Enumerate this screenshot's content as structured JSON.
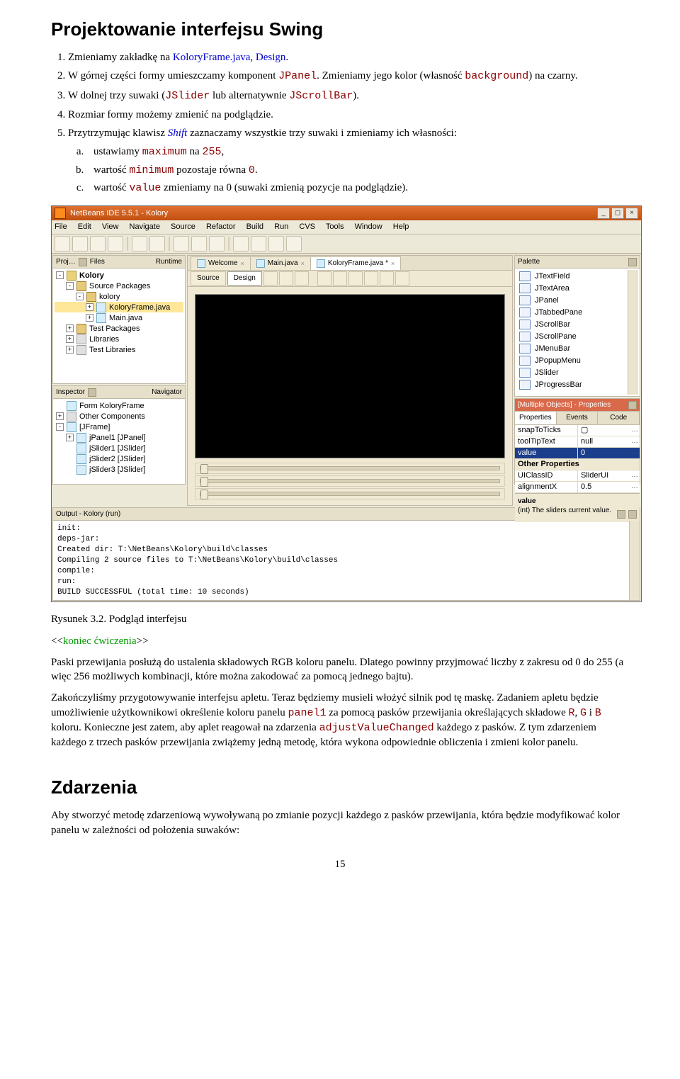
{
  "doc": {
    "heading1": "Projektowanie interfejsu Swing",
    "li1_pre": "Zmieniamy zakładkę na ",
    "li1_file": "KoloryFrame.java",
    "li1_sep": ", ",
    "li1_mode": "Design",
    "li1_post": ".",
    "li2_pre": "W górnej części formy umieszczamy komponent ",
    "li2_code": "JPanel",
    "li2_mid": ". Zmieniamy jego kolor (własność ",
    "li2_code2": "background",
    "li2_post": ") na czarny.",
    "li3_pre": "W dolnej trzy suwaki (",
    "li3_code": "JSlider",
    "li3_mid": " lub alternatywnie ",
    "li3_code2": "JScrollBar",
    "li3_post": ").",
    "li4": "Rozmiar formy możemy zmienić na podglądzie.",
    "li5_pre": "Przytrzymując klawisz ",
    "li5_shift": "Shift",
    "li5_post": " zaznaczamy wszystkie trzy suwaki i zmieniamy ich własności:",
    "li5a_pre": "ustawiamy ",
    "li5a_code": "maximum",
    "li5a_mid": " na ",
    "li5a_code2": "255",
    "li5a_post": ",",
    "li5b_pre": "wartość ",
    "li5b_code": "minimum",
    "li5b_mid": " pozostaje równa ",
    "li5b_code2": "0",
    "li5b_post": ".",
    "li5c_pre": "wartość ",
    "li5c_code": "value",
    "li5c_post": " zmieniamy na 0 (suwaki zmienią pozycje na podglądzie).",
    "fig_caption": "Rysunek 3.2. Podgląd interfejsu",
    "end_marker_pre": "<<",
    "end_marker": "koniec ćwiczenia",
    "end_marker_post": ">>",
    "para1": "Paski przewijania posłużą do ustalenia składowych RGB koloru panelu. Dlatego powinny przyjmować liczby z zakresu od 0 do 255 (a więc 256 możliwych kombinacji, które można zakodować za pomocą jednego bajtu).",
    "para2_a": "Zakończyliśmy przygotowywanie interfejsu apletu. Teraz będziemy musieli włożyć silnik pod tę maskę. Zadaniem apletu będzie umożliwienie użytkownikowi określenie koloru panelu ",
    "para2_code1": "panel1",
    "para2_b": " za pomocą pasków przewijania określających składowe ",
    "para2_R": "R",
    "para2_c": ", ",
    "para2_G": "G",
    "para2_d": " i ",
    "para2_B": "B",
    "para2_e": " koloru. Konieczne jest zatem, aby aplet reagował na zdarzenia ",
    "para2_code2": "adjustValueChanged",
    "para2_f": " każdego z pasków. Z tym zdarzeniem każdego z trzech pasków przewijania zwiążemy jedną metodę, która wykona odpowiednie obliczenia i zmieni kolor panelu.",
    "heading2": "Zdarzenia",
    "para3": "Aby stworzyć metodę zdarzeniową wywoływaną po zmianie pozycji każdego z pasków przewijania, która będzie modyfikować kolor panelu w zależności od położenia suwaków:",
    "page_num": "15"
  },
  "ide": {
    "title": "NetBeans IDE 5.5.1 - Kolory",
    "menubar": [
      "File",
      "Edit",
      "View",
      "Navigate",
      "Source",
      "Refactor",
      "Build",
      "Run",
      "CVS",
      "Tools",
      "Window",
      "Help"
    ],
    "projects": {
      "title_parts": [
        "Proj…",
        "Files",
        "Runtime"
      ],
      "root": "Kolory",
      "nodes": [
        {
          "label": "Source Packages",
          "indent": 1,
          "twisty": "-",
          "ico": "pkg"
        },
        {
          "label": "kolory",
          "indent": 2,
          "twisty": "-",
          "ico": "pkg"
        },
        {
          "label": "KoloryFrame.java",
          "indent": 3,
          "twisty": "+",
          "ico": "java",
          "selected": true
        },
        {
          "label": "Main.java",
          "indent": 3,
          "twisty": "+",
          "ico": "java"
        },
        {
          "label": "Test Packages",
          "indent": 1,
          "twisty": "+",
          "ico": "pkg"
        },
        {
          "label": "Libraries",
          "indent": 1,
          "twisty": "+",
          "ico": "lib"
        },
        {
          "label": "Test Libraries",
          "indent": 1,
          "twisty": "+",
          "ico": "lib"
        }
      ]
    },
    "inspector": {
      "title_parts": [
        "Inspector",
        "Navigator"
      ],
      "nodes": [
        {
          "label": "Form KoloryFrame",
          "indent": 0,
          "twisty": "",
          "ico": "java"
        },
        {
          "label": "Other Components",
          "indent": 0,
          "twisty": "+",
          "ico": "lib"
        },
        {
          "label": "[JFrame]",
          "indent": 0,
          "twisty": "-",
          "ico": "java"
        },
        {
          "label": "jPanel1 [JPanel]",
          "indent": 1,
          "twisty": "+",
          "ico": "java"
        },
        {
          "label": "jSlider1 [JSlider]",
          "indent": 1,
          "twisty": "",
          "ico": "java"
        },
        {
          "label": "jSlider2 [JSlider]",
          "indent": 1,
          "twisty": "",
          "ico": "java"
        },
        {
          "label": "jSlider3 [JSlider]",
          "indent": 1,
          "twisty": "",
          "ico": "java"
        }
      ]
    },
    "editor": {
      "tabs": [
        {
          "label": "Welcome",
          "close": true
        },
        {
          "label": "Main.java",
          "close": true
        },
        {
          "label": "KoloryFrame.java *",
          "close": true,
          "active": true
        }
      ],
      "design_buttons": {
        "source": "Source",
        "design": "Design"
      }
    },
    "palette": {
      "title": "Palette",
      "items": [
        "JTextField",
        "JTextArea",
        "JPanel",
        "JTabbedPane",
        "JScrollBar",
        "JScrollPane",
        "JMenuBar",
        "JPopupMenu",
        "JSlider",
        "JProgressBar"
      ]
    },
    "props": {
      "title": "[Multiple Objects] - Properties",
      "tabs": [
        "Properties",
        "Events",
        "Code"
      ],
      "rows": [
        {
          "key": "snapToTicks",
          "val": "▢"
        },
        {
          "key": "toolTipText",
          "val": "null"
        },
        {
          "key": "value",
          "val": "0",
          "selected": true
        },
        {
          "key": "Other Properties",
          "group": true
        },
        {
          "key": "UIClassID",
          "val": "SliderUI"
        },
        {
          "key": "alignmentX",
          "val": "0.5"
        }
      ],
      "desc_name": "value",
      "desc_text": "(int)  The sliders current value."
    },
    "output": {
      "title": "Output - Kolory (run)",
      "text": "init:\ndeps-jar:\nCreated dir: T:\\NetBeans\\Kolory\\build\\classes\nCompiling 2 source files to T:\\NetBeans\\Kolory\\build\\classes\ncompile:\nrun:\nBUILD SUCCESSFUL (total time: 10 seconds)"
    }
  }
}
